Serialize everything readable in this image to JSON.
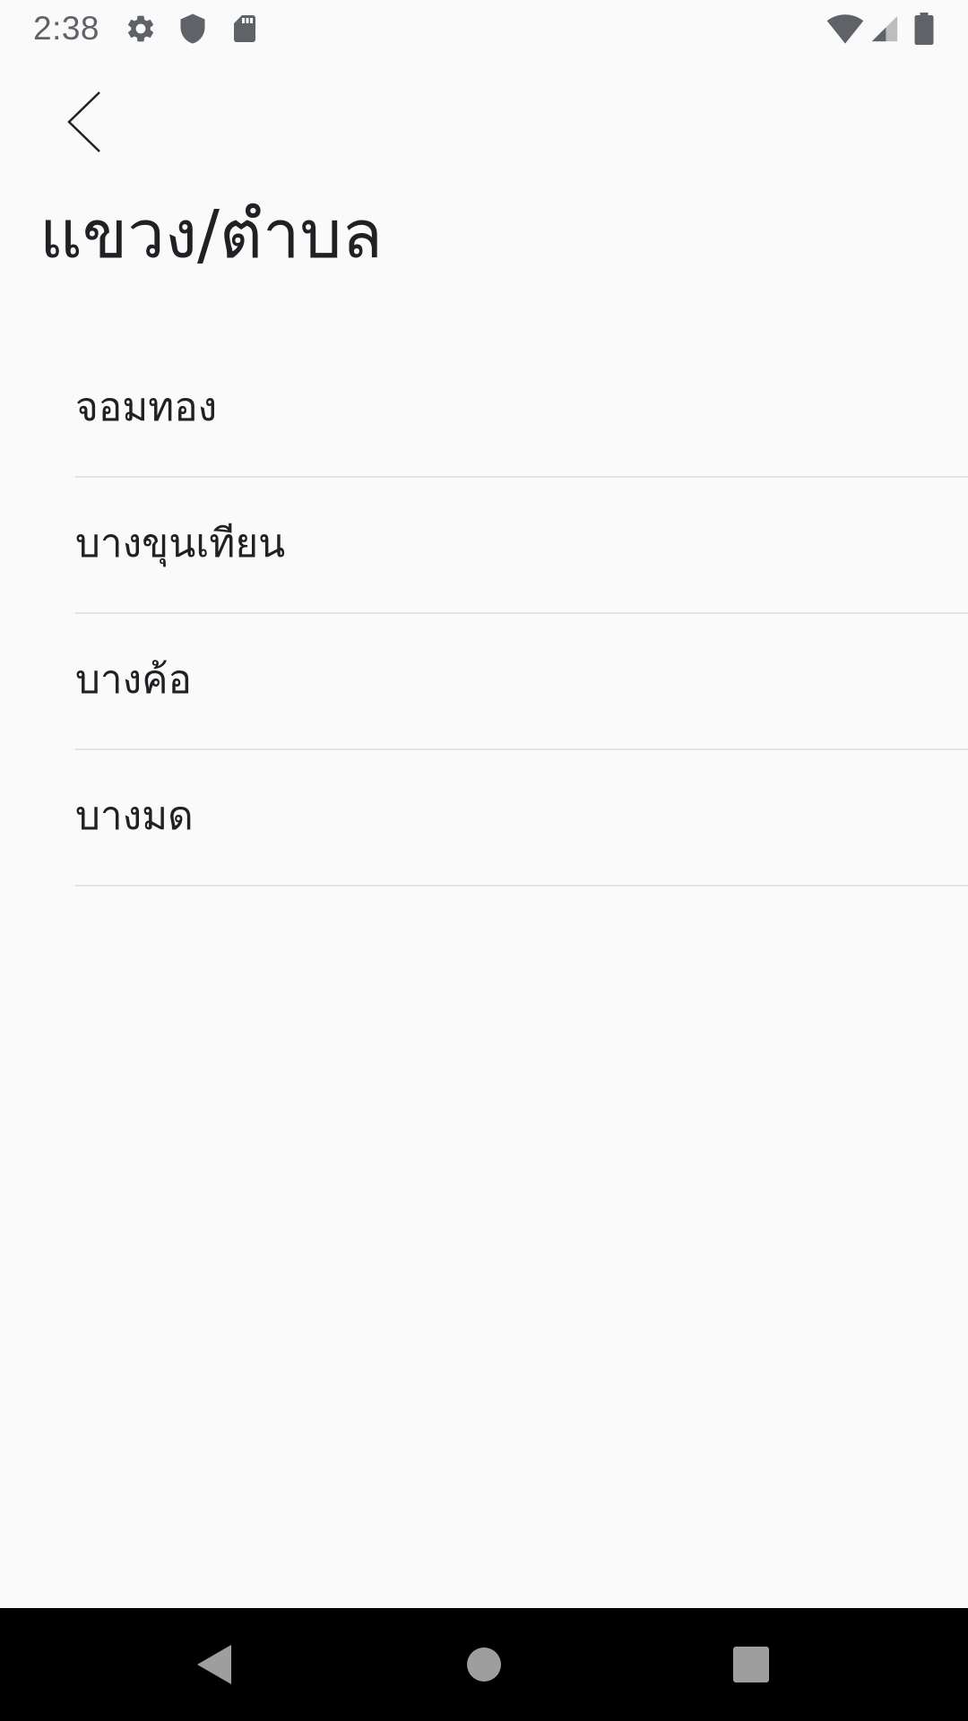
{
  "status_bar": {
    "time": "2:38",
    "icons_left": [
      "gear-icon",
      "shield-icon",
      "sd-card-icon"
    ],
    "icons_right": [
      "wifi-icon",
      "cell-signal-icon",
      "battery-icon"
    ]
  },
  "header": {
    "back_icon": "chevron-left-icon",
    "title": "แขวง/ตำบล"
  },
  "list": {
    "items": [
      {
        "label": "จอมทอง"
      },
      {
        "label": "บางขุนเทียน"
      },
      {
        "label": "บางค้อ"
      },
      {
        "label": "บางมด"
      }
    ]
  },
  "nav_bar": {
    "buttons": [
      "back-triangle-icon",
      "home-circle-icon",
      "recents-square-icon"
    ]
  },
  "colors": {
    "background": "#fafafa",
    "text": "#202124",
    "divider": "#e3e3e3",
    "status_icons": "#5f6368",
    "nav_background": "#000000",
    "nav_icons": "#9e9e9e"
  }
}
